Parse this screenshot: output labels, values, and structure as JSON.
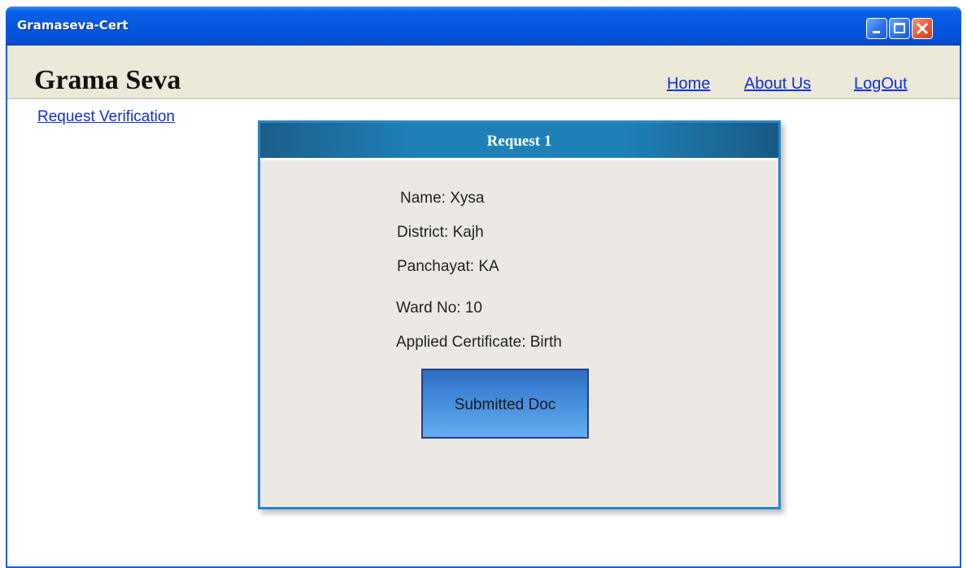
{
  "window": {
    "title": "Gramaseva-Cert",
    "controls": {
      "minimize_icon": "minimize-icon",
      "maximize_icon": "maximize-icon",
      "close_icon": "close-icon"
    }
  },
  "header": {
    "site_title": "Grama Seva",
    "nav": {
      "home": "Home",
      "about": "About Us",
      "logout": "LogOut"
    }
  },
  "sidebar": {
    "request_verification": "Request Verification"
  },
  "request_card": {
    "title": "Request 1",
    "name": "Name: Xysa",
    "district": "District: Kajh",
    "panchayat": "Panchayat: KA",
    "ward": "Ward No: 10",
    "certificate": "Applied Certificate: Birth",
    "doc_button": "Submitted Doc"
  },
  "colors": {
    "titlebar": "#0757e0",
    "header_bg": "#ece9d8",
    "link": "#0f2fd6",
    "card_border": "#2a86c7",
    "card_header": "#1f80b8",
    "doc_button": "#4a92e0"
  }
}
